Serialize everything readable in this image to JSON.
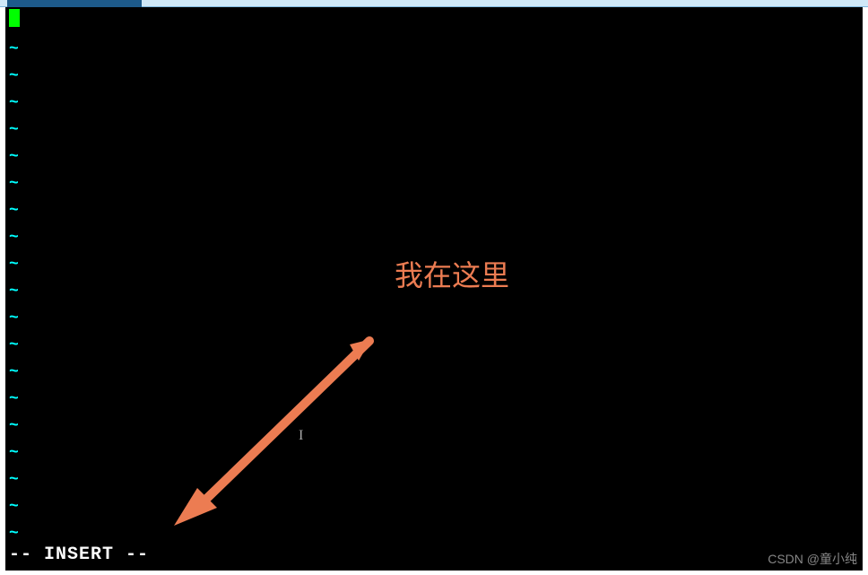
{
  "editor": {
    "cursor_line_content": "",
    "tilde_lines": [
      "~",
      "~",
      "~",
      "~",
      "~",
      "~",
      "~",
      "~",
      "~",
      "~",
      "~",
      "~",
      "~",
      "~",
      "~",
      "~",
      "~",
      "~",
      "~"
    ],
    "status_mode": "-- INSERT --",
    "text_cursor_glyph": "I"
  },
  "annotation": {
    "label": "我在这里",
    "arrow_color": "#ec7c52"
  },
  "watermark": {
    "text": "CSDN @童小纯"
  }
}
